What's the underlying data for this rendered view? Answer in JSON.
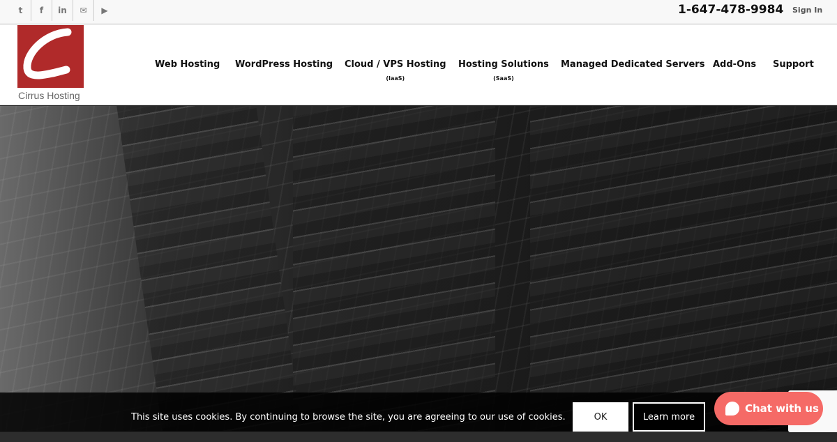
{
  "topbar": {
    "social": [
      {
        "icon": "twitter-icon",
        "glyph": "t"
      },
      {
        "icon": "facebook-icon",
        "glyph": "f"
      },
      {
        "icon": "linkedin-icon",
        "glyph": "in"
      },
      {
        "icon": "mail-icon",
        "glyph": "✉"
      },
      {
        "icon": "youtube-icon",
        "glyph": "▶"
      }
    ],
    "phone": "1-647-478-9984",
    "signin": "Sign In"
  },
  "header": {
    "logo_text": "Cirrus Hosting",
    "brand_color": "#b02a2a"
  },
  "nav": [
    {
      "label": "Web Hosting"
    },
    {
      "label": "WordPress Hosting"
    },
    {
      "label": "Cloud / VPS Hosting",
      "sub": "(IaaS)"
    },
    {
      "label": "Hosting Solutions",
      "sub": "(SaaS)"
    },
    {
      "label": "Managed Dedicated Servers"
    },
    {
      "label": "Add-Ons"
    },
    {
      "label": "Support"
    }
  ],
  "cookie": {
    "message": "This site uses cookies. By continuing to browse the site, you are agreeing to our use of cookies.",
    "ok": "OK",
    "learn_more": "Learn more"
  },
  "chat": {
    "label": "Chat with us",
    "color": "#f56a66"
  }
}
